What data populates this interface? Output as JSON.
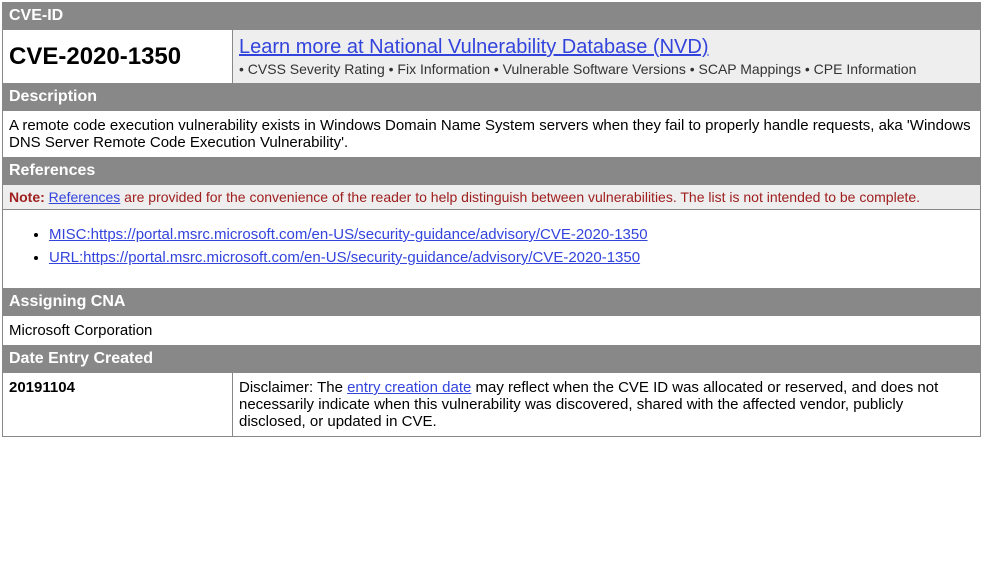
{
  "headers": {
    "cve_id": "CVE-ID",
    "description": "Description",
    "references": "References",
    "assigning_cna": "Assigning CNA",
    "date_entry_created": "Date Entry Created"
  },
  "cve_id": "CVE-2020-1350",
  "learn_more": {
    "link_text": "Learn more at National Vulnerability Database (NVD)",
    "subtext": "• CVSS Severity Rating • Fix Information • Vulnerable Software Versions • SCAP Mappings • CPE Information"
  },
  "description": "A remote code execution vulnerability exists in Windows Domain Name System servers when they fail to properly handle requests, aka 'Windows DNS Server Remote Code Execution Vulnerability'.",
  "references_note": {
    "note_label": "Note:",
    "references_link": "References",
    "text_after": " are provided for the convenience of the reader to help distinguish between vulnerabilities. The list is not intended to be complete."
  },
  "references_list": [
    "MISC:https://portal.msrc.microsoft.com/en-US/security-guidance/advisory/CVE-2020-1350",
    "URL:https://portal.msrc.microsoft.com/en-US/security-guidance/advisory/CVE-2020-1350"
  ],
  "assigning_cna": "Microsoft Corporation",
  "date_entry_created": "20191104",
  "disclaimer": {
    "prefix": "Disclaimer: The ",
    "link_text": "entry creation date",
    "suffix": " may reflect when the CVE ID was allocated or reserved, and does not necessarily indicate when this vulnerability was discovered, shared with the affected vendor, publicly disclosed, or updated in CVE."
  }
}
